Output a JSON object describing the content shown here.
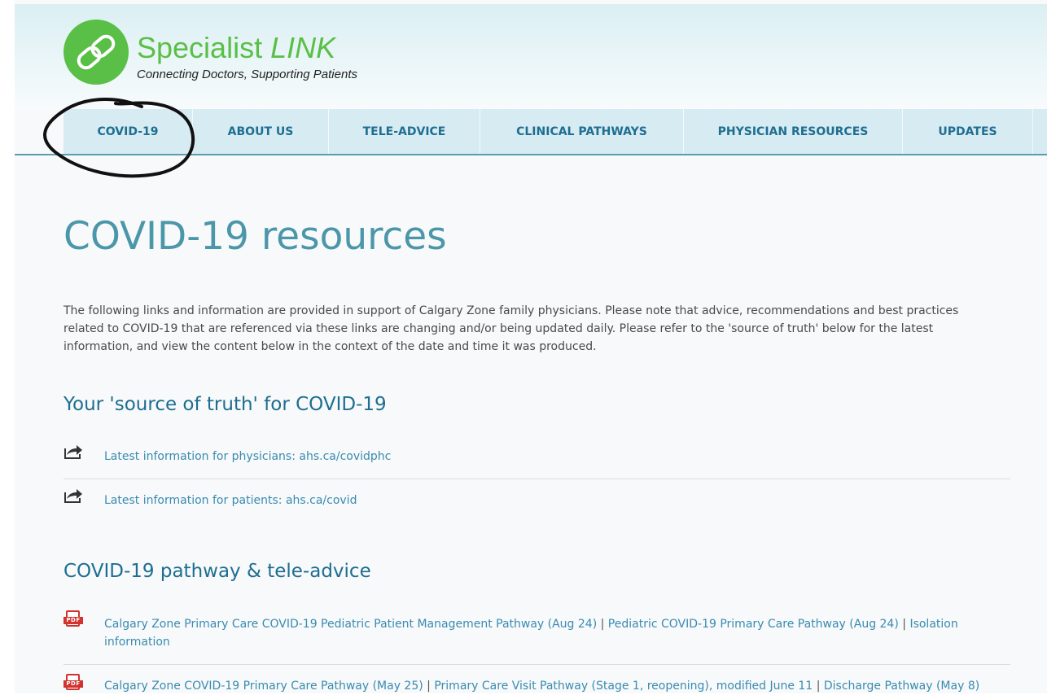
{
  "logo": {
    "title_main": "Specialist ",
    "title_em": "LINK",
    "tagline": "Connecting Doctors, Supporting Patients"
  },
  "nav": {
    "items": [
      {
        "label": "COVID-19"
      },
      {
        "label": "ABOUT US"
      },
      {
        "label": "TELE-ADVICE"
      },
      {
        "label": "CLINICAL PATHWAYS"
      },
      {
        "label": "PHYSICIAN RESOURCES"
      },
      {
        "label": "UPDATES"
      }
    ]
  },
  "main": {
    "title": "COVID-19 resources",
    "intro": "The following links and information are provided in support of Calgary Zone family physicians. Please note that advice, recommendations and best practices related to COVID-19 that are referenced via these links are changing and/or being updated daily. Please refer to the 'source of truth' below for the latest information, and view the content below in the context of the date and time it was produced.",
    "source": {
      "heading": "Your 'source of truth' for COVID-19",
      "links": [
        {
          "text": "Latest information for physicians: ahs.ca/covidphc",
          "icon": "external-link-icon"
        },
        {
          "text": "Latest information for patients: ahs.ca/covid",
          "icon": "external-link-icon"
        }
      ]
    },
    "pathway": {
      "heading": "COVID-19 pathway & tele-advice",
      "pdf_label": "PDF",
      "sep": "|",
      "rows": [
        {
          "icon": "pdf-icon",
          "links": [
            "Calgary Zone Primary Care COVID-19 Pediatric Patient Management Pathway (Aug 24)",
            "Pediatric COVID-19 Primary Care Pathway (Aug 24)",
            "Isolation information"
          ]
        },
        {
          "icon": "pdf-icon",
          "links": [
            "Calgary Zone COVID-19 Primary Care Pathway (May 25)",
            "Primary Care Visit Pathway (Stage 1, reopening), modified June 11",
            "Discharge Pathway (May 8)"
          ]
        }
      ]
    }
  },
  "colors": {
    "brand_green": "#5abf46",
    "nav_bg": "#d7ebf2",
    "nav_text": "#1e6e91",
    "title": "#4b97a9",
    "link": "#3a8bb0",
    "pdf_red": "#d2332f"
  }
}
